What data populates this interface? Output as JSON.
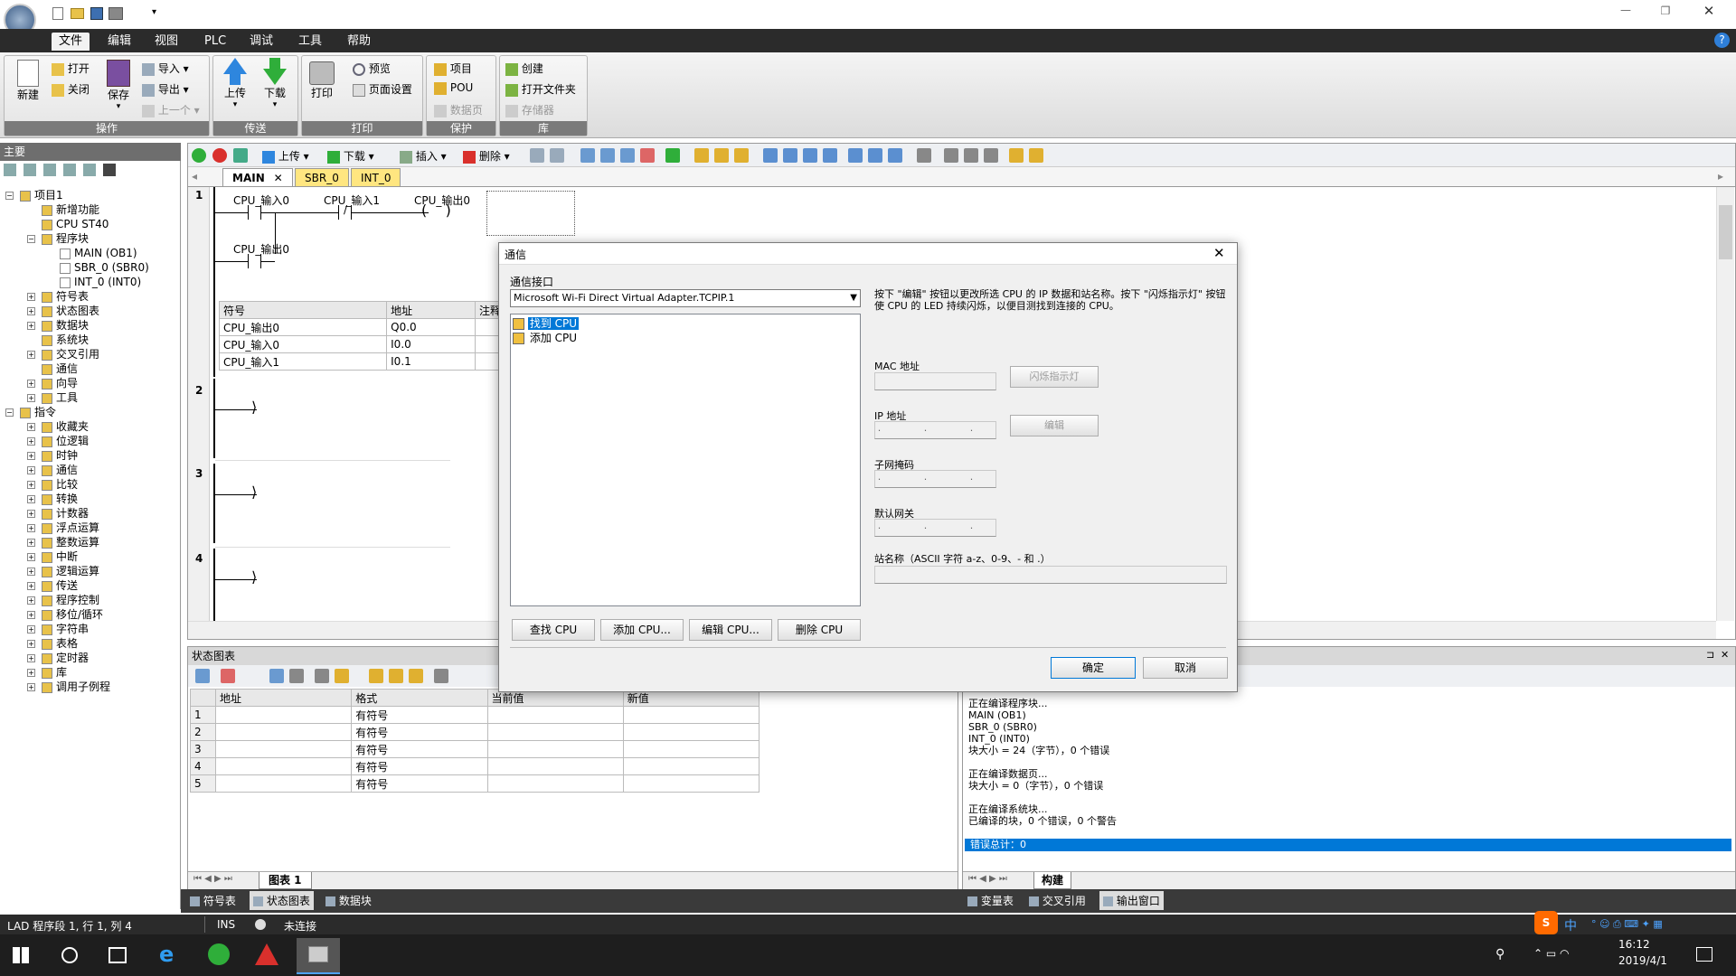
{
  "menu": {
    "items": [
      "文件",
      "编辑",
      "视图",
      "PLC",
      "调试",
      "工具",
      "帮助"
    ],
    "active": "文件"
  },
  "ribbon": {
    "ops": {
      "new": "新建",
      "open": "打开",
      "close": "关闭",
      "save": "保存",
      "import": "导入",
      "export": "导出",
      "prev": "上一个",
      "label": "操作"
    },
    "transfer": {
      "upload": "上传",
      "download": "下载",
      "label": "传送"
    },
    "print": {
      "print": "打印",
      "preview": "预览",
      "page_setup": "页面设置",
      "label": "打印"
    },
    "protect": {
      "project": "项目",
      "pou": "POU",
      "data_page": "数据页",
      "label": "保护"
    },
    "library": {
      "create": "创建",
      "open_folder": "打开文件夹",
      "memory": "存储器",
      "label": "库"
    }
  },
  "left_pane": {
    "title": "主要",
    "tree": [
      {
        "label": "项目1",
        "level": 0
      },
      {
        "label": "新增功能",
        "level": 1
      },
      {
        "label": "CPU ST40",
        "level": 1
      },
      {
        "label": "程序块",
        "level": 1
      },
      {
        "label": "MAIN (OB1)",
        "level": 2
      },
      {
        "label": "SBR_0 (SBR0)",
        "level": 2
      },
      {
        "label": "INT_0 (INT0)",
        "level": 2
      },
      {
        "label": "符号表",
        "level": 1
      },
      {
        "label": "状态图表",
        "level": 1
      },
      {
        "label": "数据块",
        "level": 1
      },
      {
        "label": "系统块",
        "level": 1
      },
      {
        "label": "交叉引用",
        "level": 1
      },
      {
        "label": "通信",
        "level": 1
      },
      {
        "label": "向导",
        "level": 1
      },
      {
        "label": "工具",
        "level": 1
      },
      {
        "label": "指令",
        "level": 0
      },
      {
        "label": "收藏夹",
        "level": 1
      },
      {
        "label": "位逻辑",
        "level": 1
      },
      {
        "label": "时钟",
        "level": 1
      },
      {
        "label": "通信",
        "level": 1
      },
      {
        "label": "比较",
        "level": 1
      },
      {
        "label": "转换",
        "level": 1
      },
      {
        "label": "计数器",
        "level": 1
      },
      {
        "label": "浮点运算",
        "level": 1
      },
      {
        "label": "整数运算",
        "level": 1
      },
      {
        "label": "中断",
        "level": 1
      },
      {
        "label": "逻辑运算",
        "level": 1
      },
      {
        "label": "传送",
        "level": 1
      },
      {
        "label": "程序控制",
        "level": 1
      },
      {
        "label": "移位/循环",
        "level": 1
      },
      {
        "label": "字符串",
        "level": 1
      },
      {
        "label": "表格",
        "level": 1
      },
      {
        "label": "定时器",
        "level": 1
      },
      {
        "label": "库",
        "level": 1
      },
      {
        "label": "调用子例程",
        "level": 1
      }
    ]
  },
  "editor": {
    "toolbar": {
      "upload": "上传",
      "download": "下载",
      "insert": "插入",
      "delete": "删除"
    },
    "tabs": [
      "MAIN",
      "SBR_0",
      "INT_0"
    ],
    "network1": {
      "num": "1",
      "contact1": "CPU_输入0",
      "contact2": "CPU_输入1",
      "coil": "CPU_输出0",
      "contact3": "CPU_输出0",
      "sym_headers": [
        "符号",
        "地址",
        "注释"
      ],
      "symbols": [
        {
          "sym": "CPU_输出0",
          "addr": "Q0.0"
        },
        {
          "sym": "CPU_输入0",
          "addr": "I0.0"
        },
        {
          "sym": "CPU_输入1",
          "addr": "I0.1"
        }
      ]
    },
    "networks": [
      "2",
      "3",
      "4"
    ]
  },
  "dialog": {
    "title": "通信",
    "iface_label": "通信接口",
    "iface_value": "Microsoft Wi-Fi Direct Virtual Adapter.TCPIP.1",
    "cpu_list": [
      "找到 CPU",
      "添加 CPU"
    ],
    "info": "按下 \"编辑\" 按钮以更改所选 CPU 的 IP 数据和站名称。按下 \"闪烁指示灯\" 按钮使 CPU 的 LED 持续闪烁，以便目测找到连接的 CPU。",
    "mac_label": "MAC 地址",
    "flash_btn": "闪烁指示灯",
    "ip_label": "IP 地址",
    "edit_btn": "编辑",
    "subnet_label": "子网掩码",
    "gateway_label": "默认网关",
    "station_label": "站名称（ASCII 字符 a-z、0-9、- 和 .）",
    "ip_dots": ". . .",
    "btn_find": "查找 CPU",
    "btn_add": "添加 CPU...",
    "btn_edit": "编辑 CPU...",
    "btn_delete": "删除 CPU",
    "btn_ok": "确定",
    "btn_cancel": "取消"
  },
  "status_chart": {
    "title": "状态图表",
    "headers": [
      "地址",
      "格式",
      "当前值",
      "新值"
    ],
    "rows": [
      {
        "n": "1",
        "fmt": "有符号"
      },
      {
        "n": "2",
        "fmt": "有符号"
      },
      {
        "n": "3",
        "fmt": "有符号"
      },
      {
        "n": "4",
        "fmt": "有符号"
      },
      {
        "n": "5",
        "fmt": "有符号"
      }
    ],
    "sheet_tab": "图表 1"
  },
  "output": {
    "lines": [
      "正在编译程序块...",
      "MAIN (OB1)",
      "SBR_0 (SBR0)",
      "INT_0 (INT0)",
      "块大小 = 24（字节），0 个错误",
      "",
      "正在编译数据页...",
      "块大小 = 0（字节），0 个错误",
      "",
      "正在编译系统块...",
      "已编译的块，0 个错误，0 个警告"
    ],
    "highlight": "错误总计：0",
    "tab": "构建"
  },
  "bottom_tabs_left": [
    "符号表",
    "状态图表",
    "数据块"
  ],
  "bottom_tabs_right": [
    "变量表",
    "交叉引用",
    "输出窗口"
  ],
  "statusbar": {
    "position": "LAD 程序段 1, 行 1, 列 4",
    "mode": "INS",
    "conn": "未连接"
  },
  "taskbar": {
    "time": "16:12",
    "date": "2019/4/1",
    "ime": "中"
  },
  "colors": {
    "accent": "#0078d7",
    "ribbon_label": "#7a7a7a",
    "tab_active": "#ffe680"
  }
}
